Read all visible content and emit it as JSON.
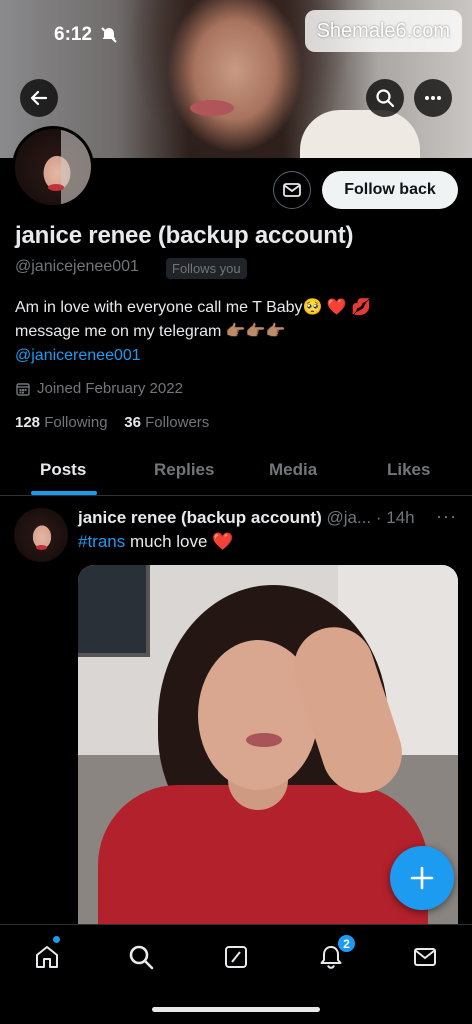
{
  "status_bar": {
    "time": "6:12"
  },
  "watermark": "Shemale6.com",
  "profile": {
    "name": "janice renee (backup account)",
    "handle": "@janicejenee001",
    "follows_you": "Follows you",
    "follow_button": "Follow back",
    "bio_line1": "Am in love with everyone call me T Baby🥺 ❤️ 💋",
    "bio_line2": "message me on my telegram 👉🏽👉🏽👉🏽",
    "bio_link": "@janicerenee001",
    "joined": "Joined February 2022",
    "following_count": "128",
    "following_label": "Following",
    "followers_count": "36",
    "followers_label": "Followers"
  },
  "tabs": [
    {
      "label": "Posts",
      "active": true
    },
    {
      "label": "Replies",
      "active": false
    },
    {
      "label": "Media",
      "active": false
    },
    {
      "label": "Likes",
      "active": false
    }
  ],
  "post": {
    "author_name": "janice renee (backup account)",
    "author_handle_time": "@ja... · 14h",
    "more": "···",
    "hashtag": "#trans",
    "text": " much love ❤️"
  },
  "bottom_nav": {
    "notifications_badge": "2",
    "icons": [
      "home-icon",
      "search-icon",
      "grok-icon",
      "bell-icon",
      "mail-icon"
    ]
  },
  "colors": {
    "accent": "#1d9bf0",
    "background": "#000000",
    "muted": "#71767b"
  }
}
